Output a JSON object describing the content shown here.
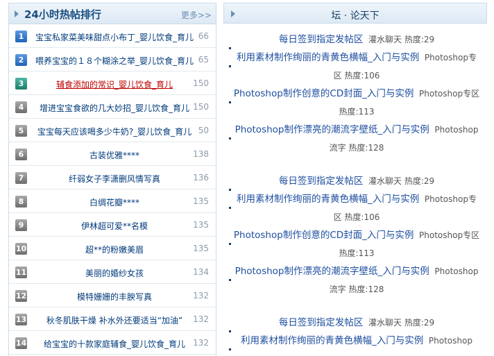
{
  "left_panel": {
    "title": "24小时热帖排行",
    "more_label": "更多>>",
    "rows": [
      {
        "rank": "1",
        "title": "宝宝私家菜美味甜点小布丁_婴儿饮食_育儿",
        "count": "66",
        "badge": "blue",
        "hot": false
      },
      {
        "rank": "2",
        "title": "喂养宝宝的１８个糊涂之举_婴儿饮食_育儿",
        "count": "65",
        "badge": "blue",
        "hot": false
      },
      {
        "rank": "3",
        "title": "辅食添加的常识_婴儿饮食_育儿",
        "count": "150",
        "badge": "teal",
        "hot": true
      },
      {
        "rank": "4",
        "title": "增进宝宝食欲的几大妙招_婴儿饮食_育儿",
        "count": "150",
        "badge": "gray",
        "hot": false
      },
      {
        "rank": "5",
        "title": "宝宝每天应该喝多少牛奶?_婴儿饮食_育儿",
        "count": "50",
        "badge": "gray",
        "hot": false
      },
      {
        "rank": "6",
        "title": "古装优雅****",
        "count": "138",
        "badge": "gray",
        "hot": false
      },
      {
        "rank": "7",
        "title": "纤弱女子李潇删风情写真",
        "count": "136",
        "badge": "gray",
        "hot": false
      },
      {
        "rank": "8",
        "title": "白绸花瓣****",
        "count": "135",
        "badge": "gray",
        "hot": false
      },
      {
        "rank": "9",
        "title": "伊林超可爱**名模",
        "count": "135",
        "badge": "gray",
        "hot": false
      },
      {
        "rank": "10",
        "title": "超**的粉嫩美眉",
        "count": "135",
        "badge": "gray",
        "hot": false
      },
      {
        "rank": "11",
        "title": "美丽的婚纱女孩",
        "count": "134",
        "badge": "gray",
        "hot": false
      },
      {
        "rank": "12",
        "title": "模特姗姗的丰腴写真",
        "count": "132",
        "badge": "gray",
        "hot": false
      },
      {
        "rank": "13",
        "title": "秋冬肌肤干燥 补水外还要适当“加油”",
        "count": "132",
        "badge": "gray",
        "hot": false
      },
      {
        "rank": "14",
        "title": "给宝宝的十款家庭辅食_婴儿饮食_育儿",
        "count": "132",
        "badge": "gray",
        "hot": false
      }
    ]
  },
  "right_panel": {
    "title": "坛 · 论天下",
    "groups": [
      {
        "items": [
          {
            "link": "每日签到指定发帖区",
            "meta": "灌水聊天 热度:29"
          },
          {
            "link": "利用素材制作绚丽的青黄色横幅_入门与实例",
            "meta": "Photoshop专区 热度:106"
          },
          {
            "link": "Photoshop制作创意的CD封面_入门与实例",
            "meta": "Photoshop专区 热度:113"
          },
          {
            "link": "Photoshop制作漂亮的潮流字壁纸_入门与实例",
            "meta": "Photoshop流字 热度:128"
          }
        ]
      },
      {
        "items": [
          {
            "link": "每日签到指定发帖区",
            "meta": "灌水聊天 热度:29"
          },
          {
            "link": "利用素材制作绚丽的青黄色横幅_入门与实例",
            "meta": "Photoshop专区 热度:106"
          },
          {
            "link": "Photoshop制作创意的CD封面_入门与实例",
            "meta": "Photoshop专区 热度:113"
          },
          {
            "link": "Photoshop制作漂亮的潮流字壁纸_入门与实例",
            "meta": "Photoshop流字 热度:128"
          }
        ]
      },
      {
        "items": [
          {
            "link": "每日签到指定发帖区",
            "meta": "灌水聊天 热度:29"
          },
          {
            "link": "利用素材制作绚丽的青黄色横幅_入门与实例",
            "meta": "Photoshop"
          }
        ]
      }
    ]
  }
}
